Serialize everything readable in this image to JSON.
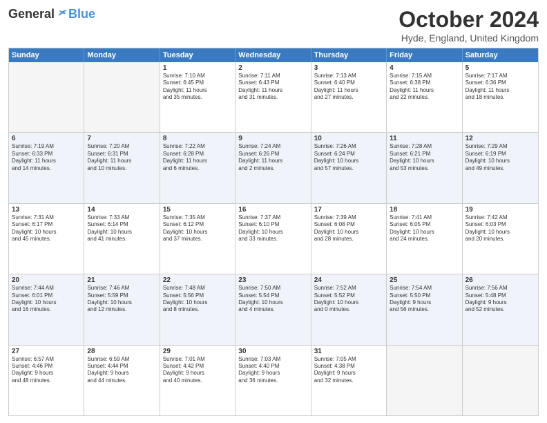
{
  "header": {
    "logo": {
      "general": "General",
      "blue": "Blue"
    },
    "title": "October 2024",
    "location": "Hyde, England, United Kingdom"
  },
  "weekdays": [
    "Sunday",
    "Monday",
    "Tuesday",
    "Wednesday",
    "Thursday",
    "Friday",
    "Saturday"
  ],
  "rows": [
    {
      "alt": false,
      "cells": [
        {
          "day": "",
          "lines": [],
          "empty": true
        },
        {
          "day": "",
          "lines": [],
          "empty": true
        },
        {
          "day": "1",
          "lines": [
            "Sunrise: 7:10 AM",
            "Sunset: 6:45 PM",
            "Daylight: 11 hours",
            "and 35 minutes."
          ]
        },
        {
          "day": "2",
          "lines": [
            "Sunrise: 7:11 AM",
            "Sunset: 6:43 PM",
            "Daylight: 11 hours",
            "and 31 minutes."
          ]
        },
        {
          "day": "3",
          "lines": [
            "Sunrise: 7:13 AM",
            "Sunset: 6:40 PM",
            "Daylight: 11 hours",
            "and 27 minutes."
          ]
        },
        {
          "day": "4",
          "lines": [
            "Sunrise: 7:15 AM",
            "Sunset: 6:38 PM",
            "Daylight: 11 hours",
            "and 22 minutes."
          ]
        },
        {
          "day": "5",
          "lines": [
            "Sunrise: 7:17 AM",
            "Sunset: 6:36 PM",
            "Daylight: 11 hours",
            "and 18 minutes."
          ]
        }
      ]
    },
    {
      "alt": true,
      "cells": [
        {
          "day": "6",
          "lines": [
            "Sunrise: 7:19 AM",
            "Sunset: 6:33 PM",
            "Daylight: 11 hours",
            "and 14 minutes."
          ]
        },
        {
          "day": "7",
          "lines": [
            "Sunrise: 7:20 AM",
            "Sunset: 6:31 PM",
            "Daylight: 11 hours",
            "and 10 minutes."
          ]
        },
        {
          "day": "8",
          "lines": [
            "Sunrise: 7:22 AM",
            "Sunset: 6:28 PM",
            "Daylight: 11 hours",
            "and 6 minutes."
          ]
        },
        {
          "day": "9",
          "lines": [
            "Sunrise: 7:24 AM",
            "Sunset: 6:26 PM",
            "Daylight: 11 hours",
            "and 2 minutes."
          ]
        },
        {
          "day": "10",
          "lines": [
            "Sunrise: 7:26 AM",
            "Sunset: 6:24 PM",
            "Daylight: 10 hours",
            "and 57 minutes."
          ]
        },
        {
          "day": "11",
          "lines": [
            "Sunrise: 7:28 AM",
            "Sunset: 6:21 PM",
            "Daylight: 10 hours",
            "and 53 minutes."
          ]
        },
        {
          "day": "12",
          "lines": [
            "Sunrise: 7:29 AM",
            "Sunset: 6:19 PM",
            "Daylight: 10 hours",
            "and 49 minutes."
          ]
        }
      ]
    },
    {
      "alt": false,
      "cells": [
        {
          "day": "13",
          "lines": [
            "Sunrise: 7:31 AM",
            "Sunset: 6:17 PM",
            "Daylight: 10 hours",
            "and 45 minutes."
          ]
        },
        {
          "day": "14",
          "lines": [
            "Sunrise: 7:33 AM",
            "Sunset: 6:14 PM",
            "Daylight: 10 hours",
            "and 41 minutes."
          ]
        },
        {
          "day": "15",
          "lines": [
            "Sunrise: 7:35 AM",
            "Sunset: 6:12 PM",
            "Daylight: 10 hours",
            "and 37 minutes."
          ]
        },
        {
          "day": "16",
          "lines": [
            "Sunrise: 7:37 AM",
            "Sunset: 6:10 PM",
            "Daylight: 10 hours",
            "and 33 minutes."
          ]
        },
        {
          "day": "17",
          "lines": [
            "Sunrise: 7:39 AM",
            "Sunset: 6:08 PM",
            "Daylight: 10 hours",
            "and 28 minutes."
          ]
        },
        {
          "day": "18",
          "lines": [
            "Sunrise: 7:41 AM",
            "Sunset: 6:05 PM",
            "Daylight: 10 hours",
            "and 24 minutes."
          ]
        },
        {
          "day": "19",
          "lines": [
            "Sunrise: 7:42 AM",
            "Sunset: 6:03 PM",
            "Daylight: 10 hours",
            "and 20 minutes."
          ]
        }
      ]
    },
    {
      "alt": true,
      "cells": [
        {
          "day": "20",
          "lines": [
            "Sunrise: 7:44 AM",
            "Sunset: 6:01 PM",
            "Daylight: 10 hours",
            "and 16 minutes."
          ]
        },
        {
          "day": "21",
          "lines": [
            "Sunrise: 7:46 AM",
            "Sunset: 5:59 PM",
            "Daylight: 10 hours",
            "and 12 minutes."
          ]
        },
        {
          "day": "22",
          "lines": [
            "Sunrise: 7:48 AM",
            "Sunset: 5:56 PM",
            "Daylight: 10 hours",
            "and 8 minutes."
          ]
        },
        {
          "day": "23",
          "lines": [
            "Sunrise: 7:50 AM",
            "Sunset: 5:54 PM",
            "Daylight: 10 hours",
            "and 4 minutes."
          ]
        },
        {
          "day": "24",
          "lines": [
            "Sunrise: 7:52 AM",
            "Sunset: 5:52 PM",
            "Daylight: 10 hours",
            "and 0 minutes."
          ]
        },
        {
          "day": "25",
          "lines": [
            "Sunrise: 7:54 AM",
            "Sunset: 5:50 PM",
            "Daylight: 9 hours",
            "and 56 minutes."
          ]
        },
        {
          "day": "26",
          "lines": [
            "Sunrise: 7:56 AM",
            "Sunset: 5:48 PM",
            "Daylight: 9 hours",
            "and 52 minutes."
          ]
        }
      ]
    },
    {
      "alt": false,
      "cells": [
        {
          "day": "27",
          "lines": [
            "Sunrise: 6:57 AM",
            "Sunset: 4:46 PM",
            "Daylight: 9 hours",
            "and 48 minutes."
          ]
        },
        {
          "day": "28",
          "lines": [
            "Sunrise: 6:59 AM",
            "Sunset: 4:44 PM",
            "Daylight: 9 hours",
            "and 44 minutes."
          ]
        },
        {
          "day": "29",
          "lines": [
            "Sunrise: 7:01 AM",
            "Sunset: 4:42 PM",
            "Daylight: 9 hours",
            "and 40 minutes."
          ]
        },
        {
          "day": "30",
          "lines": [
            "Sunrise: 7:03 AM",
            "Sunset: 4:40 PM",
            "Daylight: 9 hours",
            "and 36 minutes."
          ]
        },
        {
          "day": "31",
          "lines": [
            "Sunrise: 7:05 AM",
            "Sunset: 4:38 PM",
            "Daylight: 9 hours",
            "and 32 minutes."
          ]
        },
        {
          "day": "",
          "lines": [],
          "empty": true
        },
        {
          "day": "",
          "lines": [],
          "empty": true
        }
      ]
    }
  ]
}
